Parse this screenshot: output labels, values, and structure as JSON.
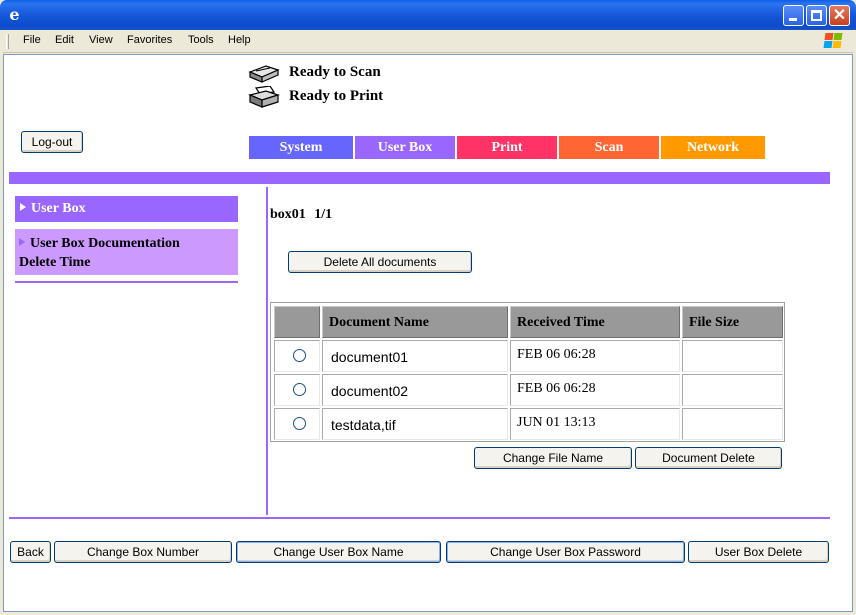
{
  "menu": [
    "File",
    "Edit",
    "View",
    "Favorites",
    "Tools",
    "Help"
  ],
  "status": {
    "scan": "Ready to Scan",
    "print": "Ready to Print"
  },
  "logout_label": "Log-out",
  "tabs": [
    {
      "label": "System",
      "color": "#6666ff"
    },
    {
      "label": "User Box",
      "color": "#9966ff"
    },
    {
      "label": "Print",
      "color": "#ff3366"
    },
    {
      "label": "Scan",
      "color": "#ff6633"
    },
    {
      "label": "Network",
      "color": "#ff9900"
    }
  ],
  "sidebar": {
    "items": [
      {
        "label": "User Box"
      },
      {
        "label_line1": "User Box Documentation",
        "label_line2": "Delete Time"
      }
    ]
  },
  "box": {
    "name": "box01",
    "page": "1/1"
  },
  "delete_all_label": "Delete All documents",
  "table": {
    "headers": [
      "",
      "Document Name",
      "Received Time",
      "File Size"
    ],
    "rows": [
      {
        "name": "document01",
        "time": "FEB 06 06:28",
        "size": ""
      },
      {
        "name": "document02",
        "time": "FEB 06 06:28",
        "size": ""
      },
      {
        "name": "testdata,tif",
        "time": "JUN 01 13:13",
        "size": ""
      }
    ]
  },
  "doc_actions": {
    "rename": "Change File Name",
    "delete": "Document Delete"
  },
  "bottom": {
    "back": "Back",
    "change_number": "Change Box Number",
    "change_name": "Change User Box Name",
    "change_password": "Change User Box Password",
    "delete_box": "User Box Delete"
  },
  "colors": {
    "accent": "#9966ff",
    "sidebar_secondary": "#cc99ff",
    "table_header": "#999999"
  }
}
